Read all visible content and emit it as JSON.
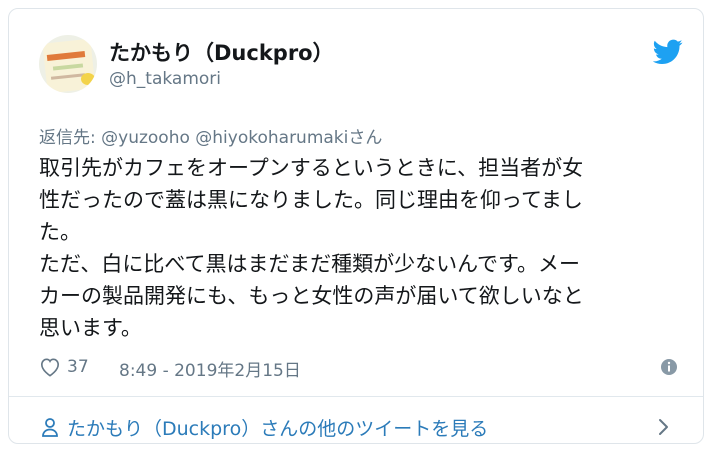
{
  "tweet": {
    "author": {
      "display_name": "たかもり（Duckpro）",
      "handle": "@h_takamori",
      "avatar_icon": "user-avatar"
    },
    "reply_to": {
      "prefix": "返信先: ",
      "mentions": "@yuzooho @hiyokoharumaki",
      "suffix": "さん"
    },
    "text_lines": [
      "取引先がカフェをオープンするというときに、担当者が女",
      "性だったので蓋は黒になりました。同じ理由を仰ってまし",
      "た。",
      "ただ、白に比べて黒はまだまだ種類が少ないんです。メー",
      "カーの製品開発にも、もっと女性の声が届いて欲しいなと",
      "思います。"
    ],
    "likes": "37",
    "timestamp": "8:49 - 2019年2月15日"
  },
  "footer": {
    "link_text": "たかもり（Duckpro）さんの他のツイートを見る"
  },
  "icons": {
    "brand": "twitter-bird-icon",
    "like": "heart-icon",
    "info": "info-icon",
    "user": "user-icon",
    "chevron": "chevron-right-icon"
  },
  "colors": {
    "twitter_blue": "#1da1f2",
    "link_blue": "#2b7bb9",
    "text": "#14171a",
    "secondary_text": "#657786",
    "border": "#e1e8ed"
  }
}
